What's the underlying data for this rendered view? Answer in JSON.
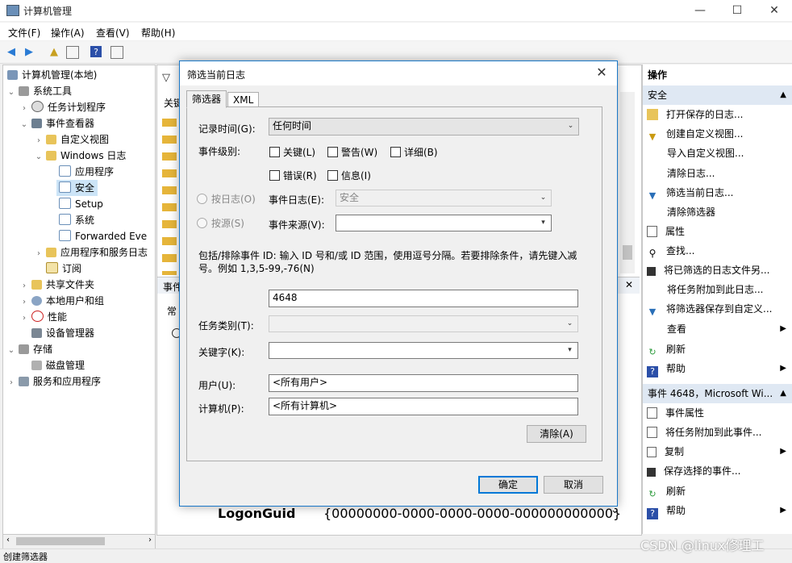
{
  "window": {
    "title": "计算机管理",
    "minimize": "—",
    "maximize": "☐",
    "close": "✕"
  },
  "menu": [
    "文件(F)",
    "操作(A)",
    "查看(V)",
    "帮助(H)"
  ],
  "tree": {
    "root": "计算机管理(本地)",
    "system_tools": "系统工具",
    "task_scheduler": "任务计划程序",
    "event_viewer": "事件查看器",
    "custom_views": "自定义视图",
    "windows_logs": "Windows 日志",
    "application": "应用程序",
    "security": "安全",
    "setup": "Setup",
    "system": "系统",
    "forwarded": "Forwarded Eve",
    "app_service_logs": "应用程序和服务日志",
    "subscriptions": "订阅",
    "shared_folders": "共享文件夹",
    "local_users": "本地用户和组",
    "performance": "性能",
    "device_manager": "设备管理器",
    "storage": "存储",
    "disk_management": "磁盘管理",
    "services_apps": "服务和应用程序"
  },
  "middle": {
    "filter_icon": "▽",
    "keyword_header": "关键",
    "event_header": "事件",
    "general_tab": "常",
    "logonguid_label": "LogonGuid",
    "logonguid_value": "{00000000-0000-0000-0000-000000000000}"
  },
  "actions": {
    "header": "操作",
    "section1": "安全",
    "items1": [
      "打开保存的日志...",
      "创建自定义视图...",
      "导入自定义视图...",
      "清除日志...",
      "筛选当前日志...",
      "清除筛选器",
      "属性",
      "查找...",
      "将已筛选的日志文件另...",
      "将任务附加到此日志...",
      "将筛选器保存到自定义...",
      "查看",
      "刷新",
      "帮助"
    ],
    "section2": "事件 4648，Microsoft Wi...",
    "items2": [
      "事件属性",
      "将任务附加到此事件...",
      "复制",
      "保存选择的事件...",
      "刷新",
      "帮助"
    ]
  },
  "dialog": {
    "title": "筛选当前日志",
    "tab_filter": "筛选器",
    "tab_xml": "XML",
    "logged_label": "记录时间(G):",
    "logged_value": "任何时间",
    "level_label": "事件级别:",
    "level_critical": "关键(L)",
    "level_warning": "警告(W)",
    "level_verbose": "详细(B)",
    "level_error": "错误(R)",
    "level_info": "信息(I)",
    "by_log": "按日志(O)",
    "event_logs_label": "事件日志(E):",
    "event_logs_value": "安全",
    "by_source": "按源(S)",
    "event_sources_label": "事件来源(V):",
    "event_sources_value": "",
    "id_hint": "包括/排除事件 ID: 输入 ID 号和/或 ID 范围，使用逗号分隔。若要排除条件，请先键入减号。例如 1,3,5-99,-76(N)",
    "event_id_value": "4648",
    "task_category_label": "任务类别(T):",
    "keywords_label": "关键字(K):",
    "user_label": "用户(U):",
    "user_value": "<所有用户>",
    "computer_label": "计算机(P):",
    "computer_value": "<所有计算机>",
    "clear_button": "清除(A)",
    "ok_button": "确定",
    "cancel_button": "取消"
  },
  "status": "创建筛选器",
  "watermark": "CSDN @linux修理工"
}
